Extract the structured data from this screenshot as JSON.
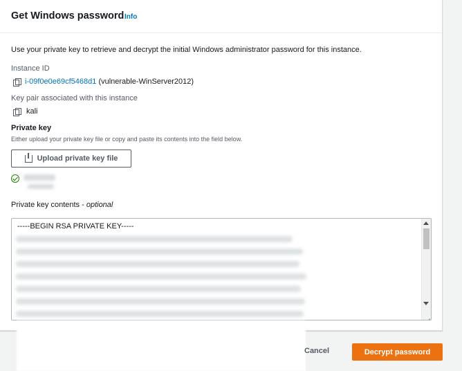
{
  "header": {
    "title": "Get Windows password",
    "info_label": "Info"
  },
  "description": "Use your private key to retrieve and decrypt the initial Windows administrator password for this instance.",
  "instance": {
    "label": "Instance ID",
    "id": "i-09f0e0e69cf5468d1",
    "name": "(vulnerable-WinServer2012)"
  },
  "key_pair": {
    "label": "Key pair associated with this instance",
    "value": "kali"
  },
  "private_key": {
    "label": "Private key",
    "hint": "Either upload your private key file or copy and paste its contents into the field below.",
    "upload_label": "Upload private key file"
  },
  "contents": {
    "label": "Private key contents - ",
    "label_optional": "optional",
    "first_line": "-----BEGIN RSA PRIVATE KEY-----"
  },
  "footer": {
    "cancel_label": "Cancel",
    "decrypt_label": "Decrypt password"
  },
  "colors": {
    "primary": "#ec7211",
    "link": "#0073bb",
    "success": "#1d8102"
  },
  "icons": [
    "copy-icon",
    "upload-icon",
    "success-check-icon"
  ]
}
